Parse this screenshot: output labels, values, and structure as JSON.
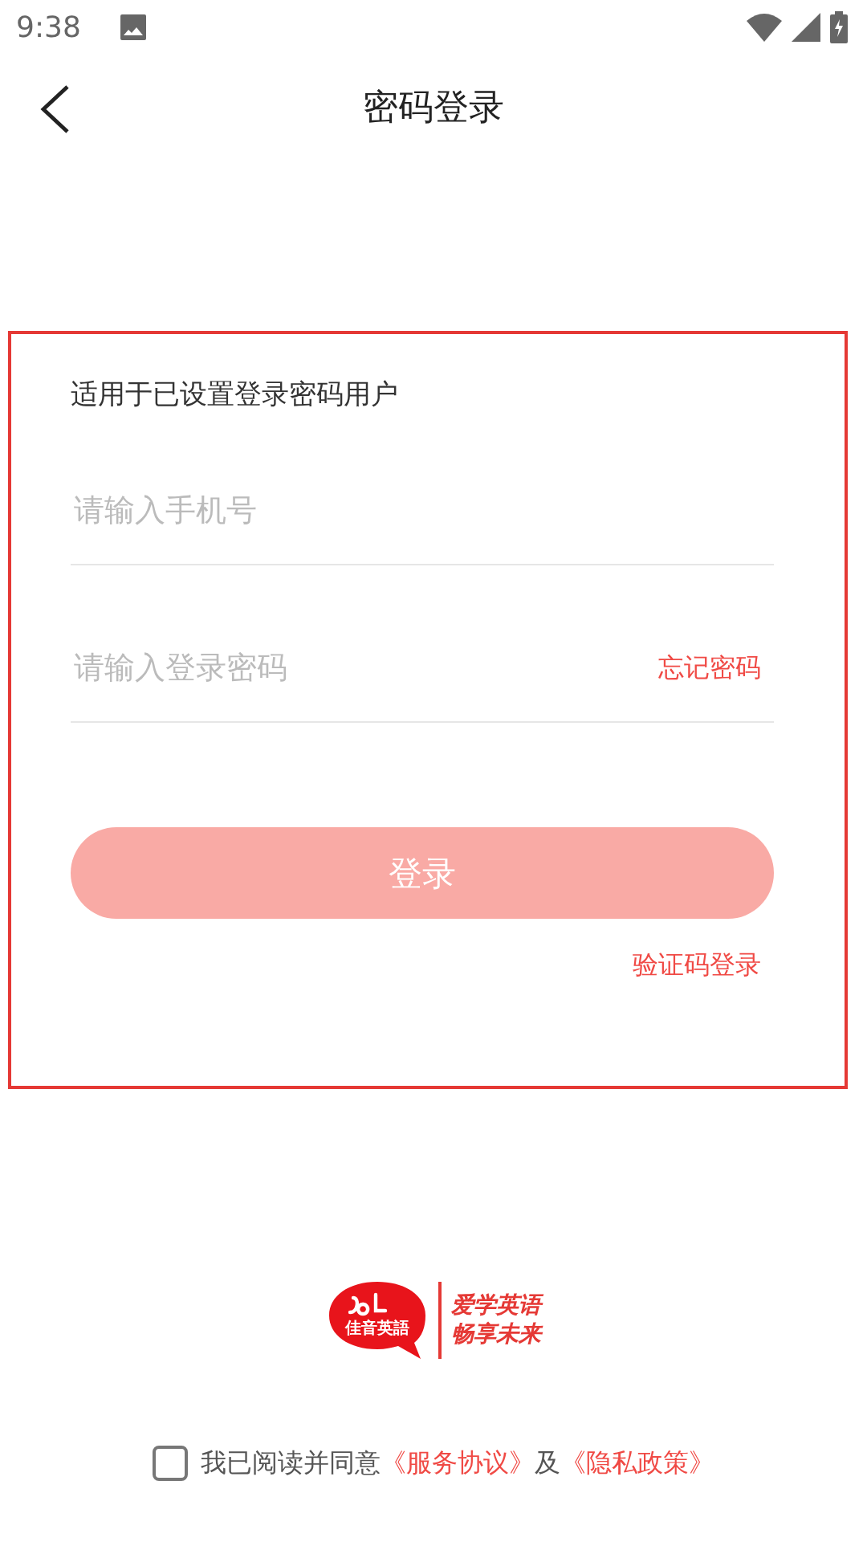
{
  "status_bar": {
    "time": "9:38"
  },
  "header": {
    "title": "密码登录"
  },
  "form": {
    "hint": "适用于已设置登录密码用户",
    "phone_field": {
      "placeholder": "请输入手机号"
    },
    "password_field": {
      "placeholder": "请输入登录密码"
    },
    "forgot_link": "忘记密码",
    "login_button": {
      "label": "登录",
      "disabled": true
    },
    "sms_login_link": "验证码登录"
  },
  "logo": {
    "badge_text": "佳音英語",
    "slogan": [
      "爱学英语",
      "畅享未来"
    ]
  },
  "agreement": {
    "checked": false,
    "prefix": "我已阅读并同意",
    "link_1": "《服务协议》",
    "connector": "及",
    "link_2": "《隐私政策》"
  }
}
